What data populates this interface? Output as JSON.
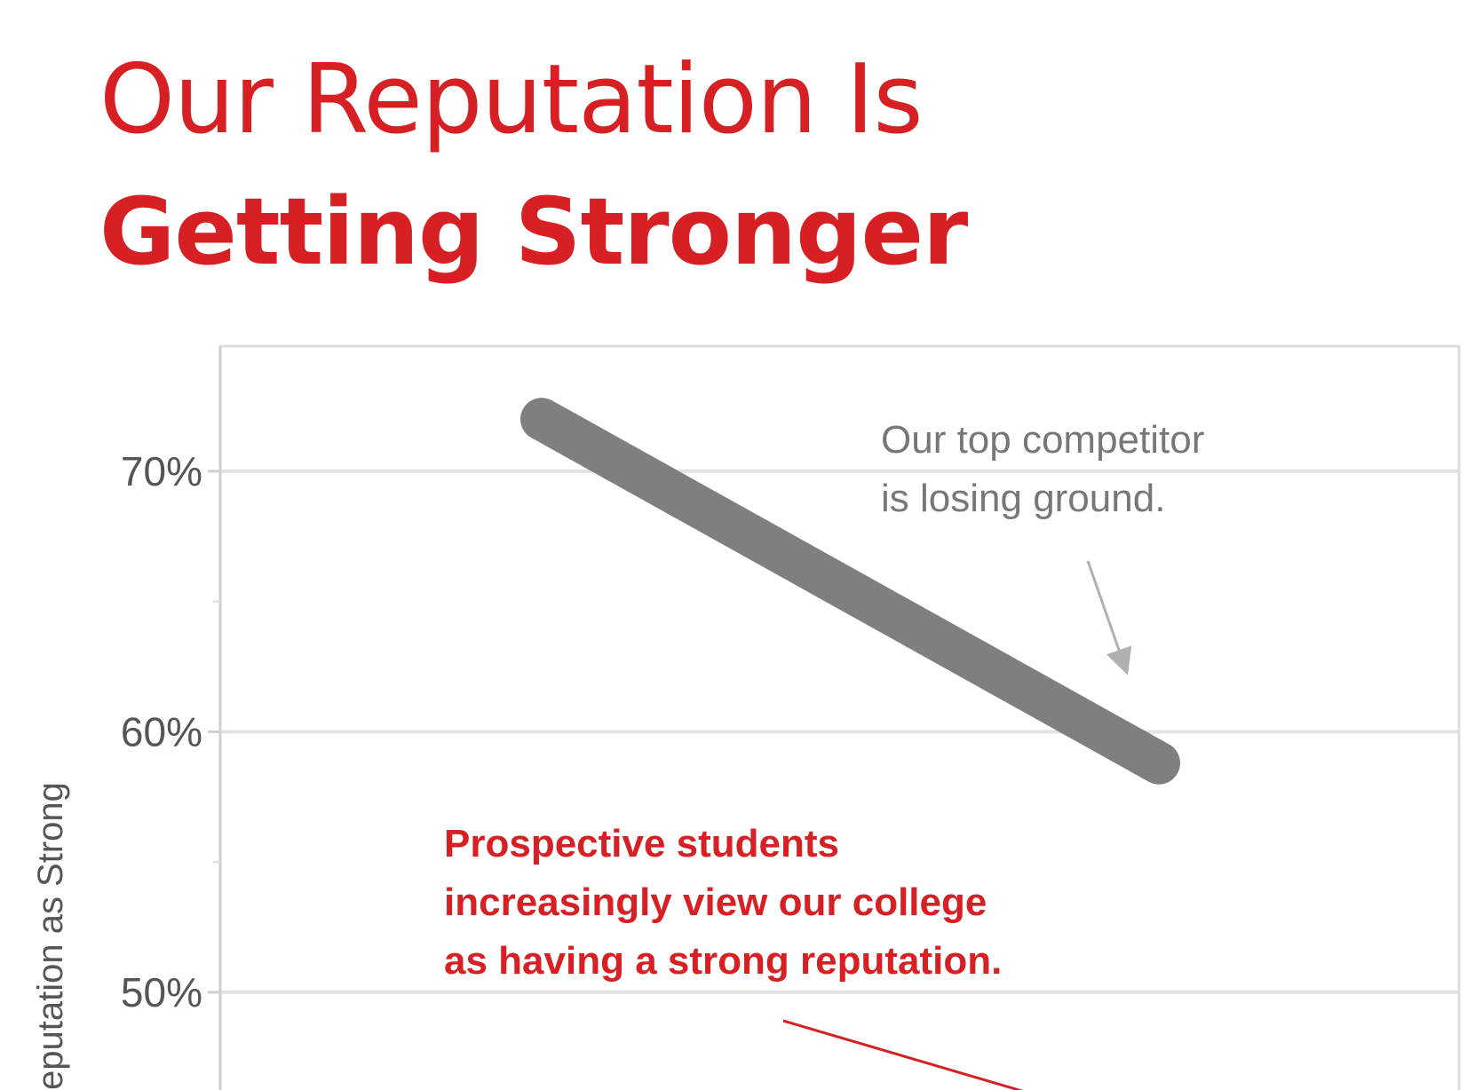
{
  "title": {
    "line1": "Our Reputation Is",
    "line2": "Getting Stronger"
  },
  "colors": {
    "title": "#d62024",
    "competitor_line": "#7f7f7f",
    "red_annotation": "#d62024",
    "gray_annotation": "#777777",
    "gridline": "#e3e3e3",
    "axis_tick_text": "#555555"
  },
  "chart_data": {
    "type": "line",
    "ylabel": "eputation as Strong",
    "ylim": [
      45.5,
      74.8
    ],
    "yticks": [
      50,
      60,
      70
    ],
    "ytick_labels": [
      "50%",
      "60%",
      "70%"
    ],
    "grid": true,
    "series": [
      {
        "role": "top-competitor",
        "color": "#7f7f7f",
        "x": [
          0,
          1
        ],
        "values": [
          72,
          58.8
        ]
      }
    ],
    "annotations": [
      {
        "lines": [
          "Our top competitor",
          "is losing ground."
        ],
        "color": "#777777"
      },
      {
        "lines": [
          "Prospective students",
          "increasingly view our college",
          "as having a strong reputation."
        ],
        "color": "#d62024"
      }
    ]
  }
}
